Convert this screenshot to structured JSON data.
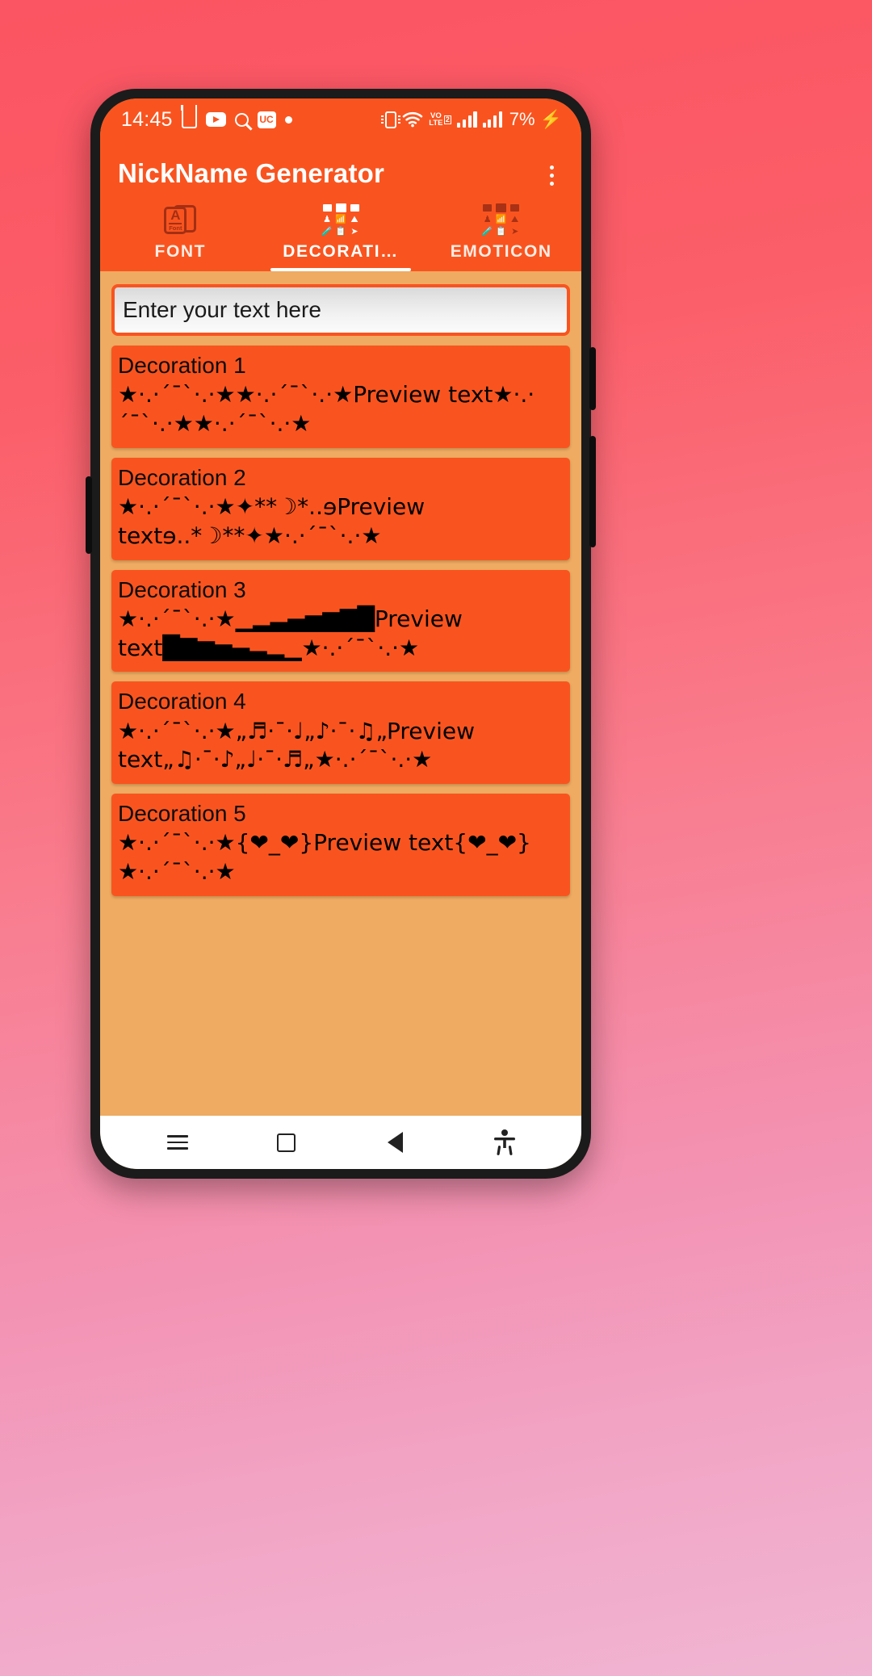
{
  "status_bar": {
    "time": "14:45",
    "left_icons": [
      "u-app-icon",
      "youtube-icon",
      "search-icon",
      "uc-browser-icon",
      "notification-dot-icon"
    ],
    "uc_label": "UC",
    "right_icons": [
      "vibrate-icon",
      "wifi-icon",
      "volte-icon",
      "signal-sim1-icon",
      "signal-sim2-icon"
    ],
    "volte_top": "VO",
    "volte_bottom": "LTE",
    "volte_sim": "2",
    "battery_percent": "7%",
    "charging_glyph": "⚡"
  },
  "app_bar": {
    "title": "NickName Generator",
    "overflow_icon": "overflow-menu-icon"
  },
  "tabs": [
    {
      "label": "FONT",
      "icon": "font-card-icon",
      "active": false
    },
    {
      "label": "DECORATI…",
      "icon": "decoration-grid-icon",
      "active": true
    },
    {
      "label": "EMOTICON",
      "icon": "emoticon-grid-icon",
      "active": false
    }
  ],
  "input": {
    "value": "",
    "placeholder": "Enter your text here"
  },
  "decorations": [
    {
      "title": "Decoration 1",
      "preview": "★·.·´¯`·.·★★·.·´¯`·.·★Preview text★·.·´¯`·.·★★·.·´¯`·.·★"
    },
    {
      "title": "Decoration 2",
      "preview": "★·.·´¯`·.·★✦**☽*..ɘPreview textɘ..*☽**✦★·.·´¯`·.·★"
    },
    {
      "title": "Decoration 3",
      "preview": "★·.·´¯`·.·★▁▂▃▄▅▆▇█Preview text█▇▆▅▄▃▂▁★·.·´¯`·.·★"
    },
    {
      "title": "Decoration 4",
      "preview": "★·.·´¯`·.·★„♬·¯·♩„♪·¯·♫„Preview text„♫·¯·♪„♩·¯·♬„★·.·´¯`·.·★"
    },
    {
      "title": "Decoration 5",
      "preview": "★·.·´¯`·.·★{❤_❤}Preview text{❤_❤}★·.·´¯`·.·★"
    }
  ],
  "nav_bar": {
    "recents_label": "recents-icon",
    "home_label": "home-icon",
    "back_label": "back-icon",
    "accessibility_label": "accessibility-icon"
  },
  "colors": {
    "accent": "#f9541f",
    "content_bg": "#eeab61",
    "wallpaper_top": "#fb5462",
    "wallpaper_bottom": "#f0b5d2"
  }
}
